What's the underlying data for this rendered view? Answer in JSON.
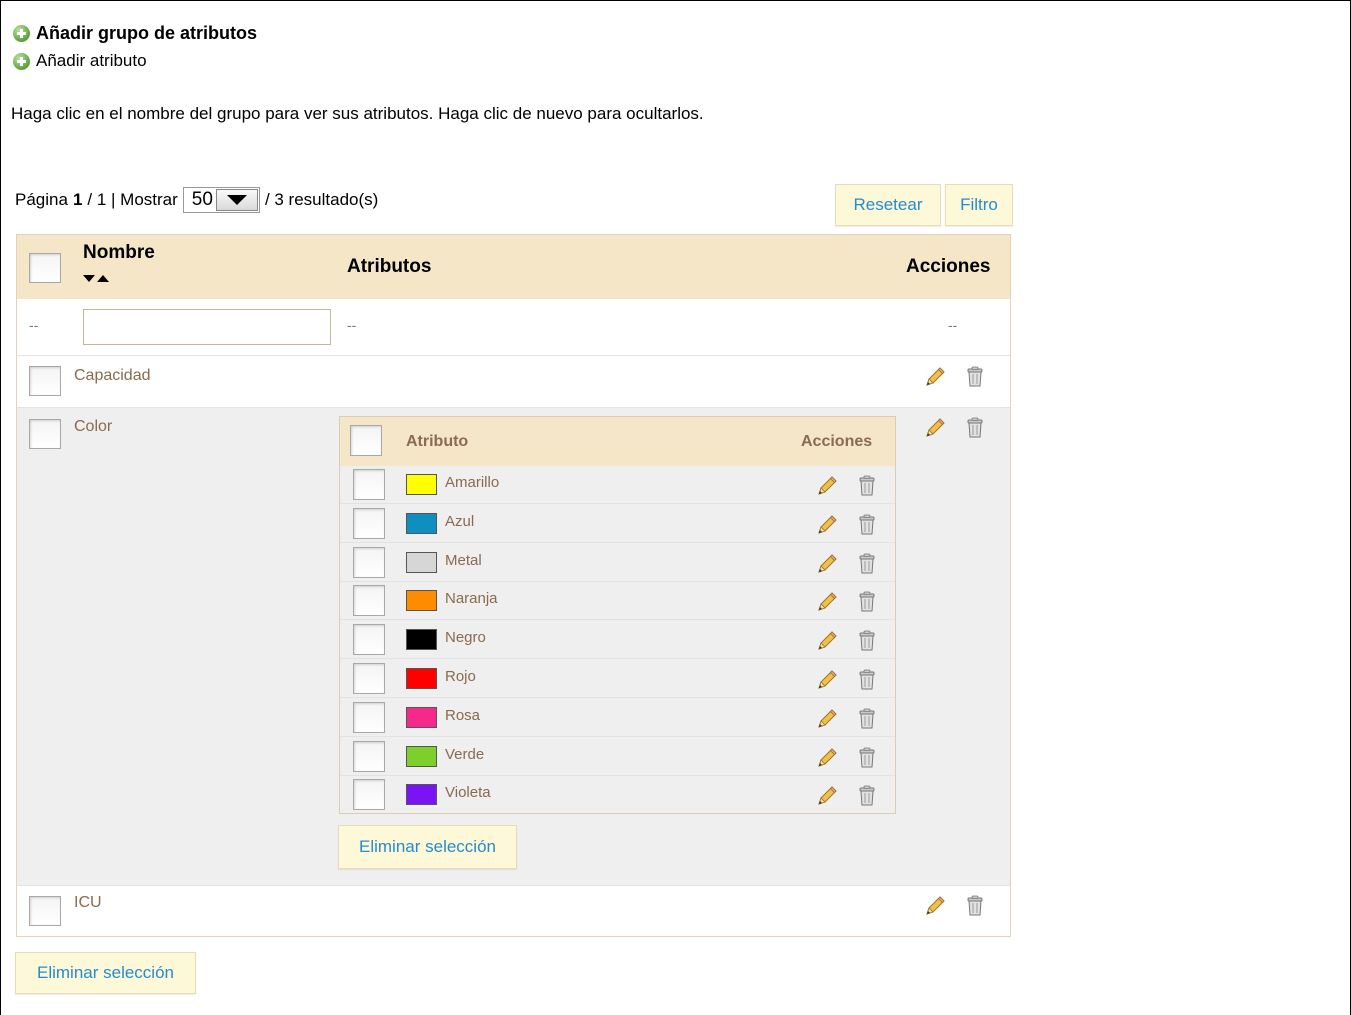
{
  "links": {
    "add_group": "Añadir grupo de atributos",
    "add_attribute": "Añadir atributo"
  },
  "help_text": "Haga clic en el nombre del grupo para ver sus atributos. Haga clic de nuevo para ocultarlos.",
  "pagination": {
    "page_label": "Página",
    "current_page": "1",
    "total_pages_text": "/ 1 | Mostrar",
    "per_page": "50",
    "results_text": "/ 3 resultado(s)"
  },
  "toolbar": {
    "reset": "Resetear",
    "filter": "Filtro"
  },
  "table": {
    "headers": {
      "name": "Nombre",
      "attributes": "Atributos",
      "actions": "Acciones"
    },
    "filter_row": {
      "dash_left": "--",
      "dash_attr": "--",
      "dash_actions": "--",
      "name_value": ""
    },
    "groups": [
      {
        "name": "Capacidad"
      },
      {
        "name": "Color"
      },
      {
        "name": "ICU"
      }
    ]
  },
  "sub_table": {
    "headers": {
      "attribute": "Atributo",
      "actions": "Acciones"
    },
    "rows": [
      {
        "name": "Amarillo",
        "color": "#ffff00"
      },
      {
        "name": "Azul",
        "color": "#0e8fc0"
      },
      {
        "name": "Metal",
        "color": "#d6d6d6"
      },
      {
        "name": "Naranja",
        "color": "#ff8c00"
      },
      {
        "name": "Negro",
        "color": "#000000"
      },
      {
        "name": "Rojo",
        "color": "#ff0000"
      },
      {
        "name": "Rosa",
        "color": "#f5298a"
      },
      {
        "name": "Verde",
        "color": "#7fcf2c"
      },
      {
        "name": "Violeta",
        "color": "#7b14f5"
      }
    ],
    "delete_selection": "Eliminar selección"
  },
  "delete_selection": "Eliminar selección",
  "colors": {
    "header_bg": "#f5e6c8",
    "link_blue": "#268ccd",
    "group_text": "#8a6b4d",
    "expanded_bg": "#efefef"
  }
}
